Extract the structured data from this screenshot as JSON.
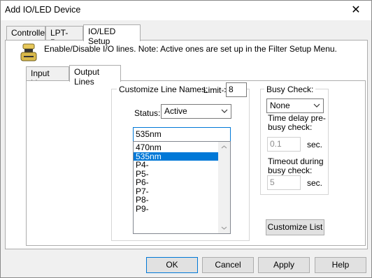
{
  "window": {
    "title": "Add IO/LED Device",
    "close_glyph": "✕"
  },
  "tabs": [
    "Controller",
    "LPT-Port",
    "IO/LED Setup"
  ],
  "info_text": "Enable/Disable I/O lines. Note: Active ones are set up in the Filter Setup Menu.",
  "inner_tabs": [
    "Input Lines",
    "Output Lines"
  ],
  "customize": {
    "label": "Customize Line Names:",
    "limit_label": "Limit->",
    "limit_value": "8",
    "status_label": "Status:",
    "status_value": "Active",
    "name_value": "535nm",
    "list_items": [
      "470nm",
      "535nm",
      "P4-",
      "P5-",
      "P6-",
      "P7-",
      "P8-",
      "P9-"
    ],
    "selected_index": 1
  },
  "busy": {
    "label": "Busy Check:",
    "combo_value": "None",
    "pre_label_1": "Time delay pre-",
    "pre_label_2": "busy check:",
    "pre_value": "0.1",
    "pre_unit": "sec.",
    "timeout_label_1": "Timeout during",
    "timeout_label_2": "busy check:",
    "timeout_value": "5",
    "timeout_unit": "sec."
  },
  "customize_list_button": "Customize List",
  "buttons": {
    "ok": "OK",
    "cancel": "Cancel",
    "apply": "Apply",
    "help": "Help"
  }
}
